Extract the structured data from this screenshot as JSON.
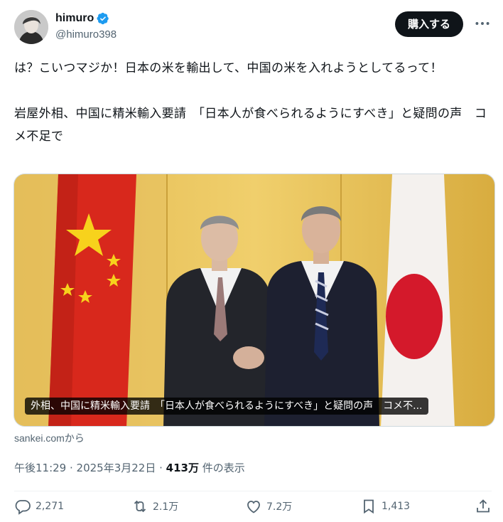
{
  "user": {
    "display_name": "himuro",
    "handle": "@himuro398",
    "verified_icon": "verified-badge-icon"
  },
  "header": {
    "buy_label": "購入する",
    "more_icon": "more-icon"
  },
  "tweet": {
    "text": "は？こいつマジか！日本の米を輸出して、中国の米を入れようとしてるって！\n\n岩屋外相、中国に精米輸入要請　「日本人が食べられるようにすべき」と疑問の声　コメ不足で"
  },
  "media": {
    "caption": "外相、中国に精米輸入要請　「日本人が食べられるようにすべき」と疑問の声　コメ不..."
  },
  "source": "sankei.comから",
  "meta": {
    "time": "午後11:29",
    "sep1": " · ",
    "date": "2025年3月22日",
    "sep2": " · ",
    "views": "413万",
    "views_label": " 件の表示"
  },
  "actions": {
    "replies": "2,271",
    "reposts": "2.1万",
    "likes": "7.2万",
    "bookmarks": "1,413"
  },
  "colors": {
    "accent": "#1d9bf0",
    "text": "#0f1419",
    "muted": "#536471",
    "china_red": "#de2910",
    "gold": "#d9b24a"
  }
}
